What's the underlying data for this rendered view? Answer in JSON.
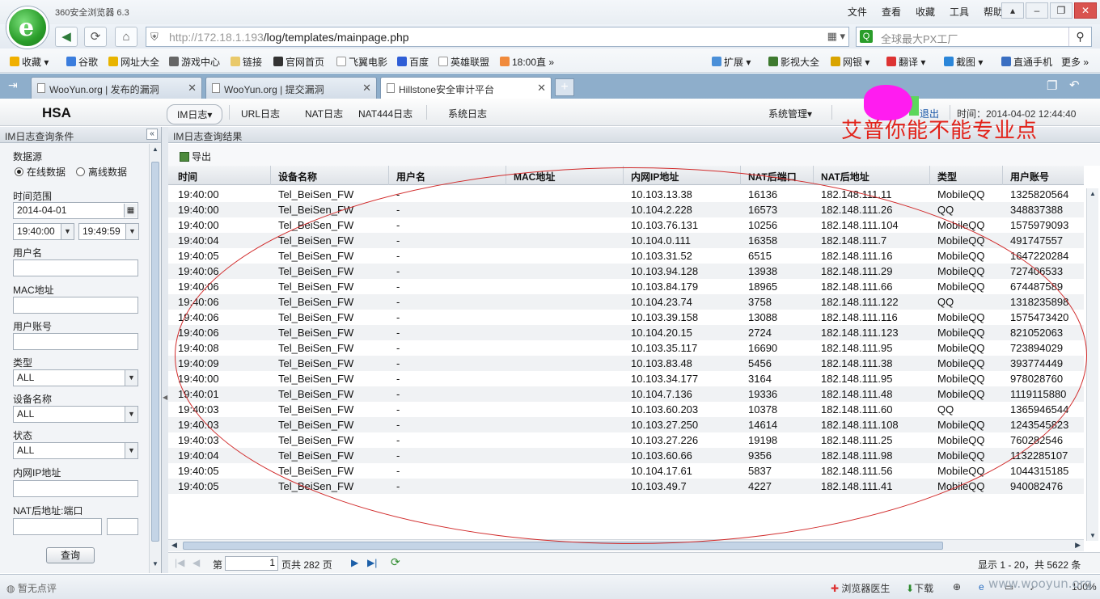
{
  "browser": {
    "app_title": "360安全浏览器 6.3",
    "menu": [
      "文件",
      "查看",
      "收藏",
      "工具",
      "帮助"
    ],
    "url_host": "http://172.18.1.193",
    "url_path": "/log/templates/mainpage.php",
    "search_placeholder": "全球最大PX工厂",
    "favorites": [
      "收藏",
      "谷歌",
      "网址大全",
      "游戏中心",
      "链接",
      "官网首页",
      "飞翼电影",
      "百度",
      "英雄联盟",
      "18:00直"
    ],
    "favbar_right": [
      "扩展",
      "影视大全",
      "网银",
      "翻译",
      "截图",
      "直通手机",
      "更多"
    ],
    "tabs": [
      {
        "title": "WooYun.org | 发布的漏洞"
      },
      {
        "title": "WooYun.org | 提交漏洞"
      },
      {
        "title": "Hillstone安全审计平台"
      }
    ],
    "status": {
      "left": "暂无点评",
      "doctor": "浏览器医生",
      "download": "下载",
      "zoom": "100%"
    }
  },
  "app": {
    "brand": "HSA",
    "nav": [
      "IM日志▾",
      "URL日志",
      "NAT日志",
      "NAT444日志",
      "系统日志"
    ],
    "admin_menu": "系统管理▾",
    "logout": "退出",
    "time": "时间：2014-04-02 12:44:40",
    "scrawl": "艾普你能不能专业点"
  },
  "query": {
    "panel_title": "IM日志查询条件",
    "source_label": "数据源",
    "source_online": "在线数据",
    "source_offline": "离线数据",
    "time_range_label": "时间范围",
    "date": "2014-04-01",
    "time_from": "19:40:00",
    "time_to": "19:49:59",
    "username_label": "用户名",
    "mac_label": "MAC地址",
    "account_label": "用户账号",
    "type_label": "类型",
    "type_value": "ALL",
    "device_label": "设备名称",
    "device_value": "ALL",
    "state_label": "状态",
    "state_value": "ALL",
    "ip_label": "内网IP地址",
    "nat_label": "NAT后地址:端口",
    "query_button": "查询"
  },
  "results": {
    "panel_title": "IM日志查询结果",
    "export_label": "导出",
    "columns": [
      "时间",
      "设备名称",
      "用户名",
      "MAC地址",
      "内网IP地址",
      "NAT后端口",
      "NAT后地址",
      "类型",
      "用户账号"
    ],
    "rows": [
      [
        "19:40:00",
        "Tel_BeiSen_FW",
        "-",
        "",
        "10.103.13.38",
        "16136",
        "182.148.111.11",
        "MobileQQ",
        "1325820564"
      ],
      [
        "19:40:00",
        "Tel_BeiSen_FW",
        "-",
        "",
        "10.104.2.228",
        "16573",
        "182.148.111.26",
        "QQ",
        "348837388"
      ],
      [
        "19:40:00",
        "Tel_BeiSen_FW",
        "-",
        "",
        "10.103.76.131",
        "10256",
        "182.148.111.104",
        "MobileQQ",
        "1575979093"
      ],
      [
        "19:40:04",
        "Tel_BeiSen_FW",
        "-",
        "",
        "10.104.0.111",
        "16358",
        "182.148.111.7",
        "MobileQQ",
        "491747557"
      ],
      [
        "19:40:05",
        "Tel_BeiSen_FW",
        "-",
        "",
        "10.103.31.52",
        "6515",
        "182.148.111.16",
        "MobileQQ",
        "1647220284"
      ],
      [
        "19:40:06",
        "Tel_BeiSen_FW",
        "-",
        "",
        "10.103.94.128",
        "13938",
        "182.148.111.29",
        "MobileQQ",
        "727406533"
      ],
      [
        "19:40:06",
        "Tel_BeiSen_FW",
        "-",
        "",
        "10.103.84.179",
        "18965",
        "182.148.111.66",
        "MobileQQ",
        "674487589"
      ],
      [
        "19:40:06",
        "Tel_BeiSen_FW",
        "-",
        "",
        "10.104.23.74",
        "3758",
        "182.148.111.122",
        "QQ",
        "1318235898"
      ],
      [
        "19:40:06",
        "Tel_BeiSen_FW",
        "-",
        "",
        "10.103.39.158",
        "13088",
        "182.148.111.116",
        "MobileQQ",
        "1575473420"
      ],
      [
        "19:40:06",
        "Tel_BeiSen_FW",
        "-",
        "",
        "10.104.20.15",
        "2724",
        "182.148.111.123",
        "MobileQQ",
        "821052063"
      ],
      [
        "19:40:08",
        "Tel_BeiSen_FW",
        "-",
        "",
        "10.103.35.117",
        "16690",
        "182.148.111.95",
        "MobileQQ",
        "723894029"
      ],
      [
        "19:40:09",
        "Tel_BeiSen_FW",
        "-",
        "",
        "10.103.83.48",
        "5456",
        "182.148.111.38",
        "MobileQQ",
        "393774449"
      ],
      [
        "19:40:00",
        "Tel_BeiSen_FW",
        "-",
        "",
        "10.103.34.177",
        "3164",
        "182.148.111.95",
        "MobileQQ",
        "978028760"
      ],
      [
        "19:40:01",
        "Tel_BeiSen_FW",
        "-",
        "",
        "10.104.7.136",
        "19336",
        "182.148.111.48",
        "MobileQQ",
        "1119115880"
      ],
      [
        "19:40:03",
        "Tel_BeiSen_FW",
        "-",
        "",
        "10.103.60.203",
        "10378",
        "182.148.111.60",
        "QQ",
        "1365946544"
      ],
      [
        "19:40:03",
        "Tel_BeiSen_FW",
        "-",
        "",
        "10.103.27.250",
        "14614",
        "182.148.111.108",
        "MobileQQ",
        "1243545823"
      ],
      [
        "19:40:03",
        "Tel_BeiSen_FW",
        "-",
        "",
        "10.103.27.226",
        "19198",
        "182.148.111.25",
        "MobileQQ",
        "760282546"
      ],
      [
        "19:40:04",
        "Tel_BeiSen_FW",
        "-",
        "",
        "10.103.60.66",
        "9356",
        "182.148.111.98",
        "MobileQQ",
        "1132285107"
      ],
      [
        "19:40:05",
        "Tel_BeiSen_FW",
        "-",
        "",
        "10.104.17.61",
        "5837",
        "182.148.111.56",
        "MobileQQ",
        "1044315185"
      ],
      [
        "19:40:05",
        "Tel_BeiSen_FW",
        "-",
        "",
        "10.103.49.7",
        "4227",
        "182.148.111.41",
        "MobileQQ",
        "940082476"
      ]
    ],
    "pager": {
      "page_prefix": "第",
      "page_value": "1",
      "page_suffix": "页共 282 页",
      "summary": "显示 1 - 20，共 5622 条"
    }
  },
  "watermark": "www.wooyun.org"
}
